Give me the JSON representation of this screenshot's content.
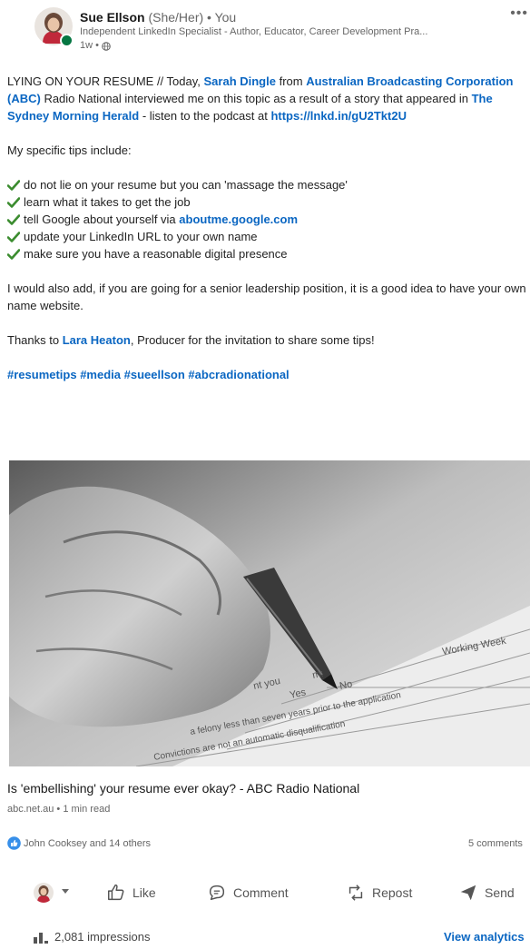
{
  "author": {
    "name": "Sue Ellson",
    "pronouns": "(She/Her)",
    "connection": "• You",
    "headline": "Independent LinkedIn Specialist - Author, Educator, Career Development Pra...",
    "time": "1w •",
    "visibility_icon": "globe-icon",
    "more_icon": "ellipsis-icon"
  },
  "post": {
    "intro_1": "LYING ON YOUR RESUME // Today, ",
    "mention_1": "Sarah Dingle",
    "intro_2": " from ",
    "mention_2": "Australian Broadcasting Corporation (ABC)",
    "intro_3": " Radio National interviewed me on this topic as a result of a story that appeared in ",
    "mention_3": "The Sydney Morning Herald",
    "intro_4": " - listen to the podcast at ",
    "podcast_link": "https://lnkd.in/gU2Tkt2U",
    "tips_heading": "My specific tips include:",
    "tip_1": "do not lie on your resume but you can 'massage the message'",
    "tip_2": "learn what it takes to get the job",
    "tip_3_prefix": "tell Google about yourself via ",
    "tip_3_link": "aboutme.google.com",
    "tip_4": "update your LinkedIn URL to your own name",
    "tip_5": "make sure you have a reasonable digital presence",
    "addition": "I would also add, if you are going for a senior leadership position, it is a good idea to have your own name website.",
    "thanks_1": "Thanks to ",
    "thanks_mention": "Lara Heaton",
    "thanks_2": ", Producer for the invitation to share some tips!",
    "hashtags": "#resumetips #media #sueellson #abcradionational"
  },
  "article": {
    "title": "Is 'embellishing' your resume ever okay? - ABC Radio National",
    "source": "abc.net.au • 1 min read",
    "form_text": {
      "yes": "Yes",
      "no": "No",
      "working": "Working Week",
      "line1": "a felony less than seven years prior to the application",
      "line2": "Convictions are not an automatic disqualification",
      "nt_you": "nt you",
      "m": "m:"
    }
  },
  "social": {
    "reactions": "John Cooksey and 14 others",
    "comments": "5 comments"
  },
  "actions": {
    "like": "Like",
    "comment": "Comment",
    "repost": "Repost",
    "send": "Send"
  },
  "analytics": {
    "impressions": "2,081 impressions",
    "view": "View analytics"
  },
  "colors": {
    "link": "#0a66c2",
    "online": "#057642",
    "check": "#3b8c2f"
  }
}
